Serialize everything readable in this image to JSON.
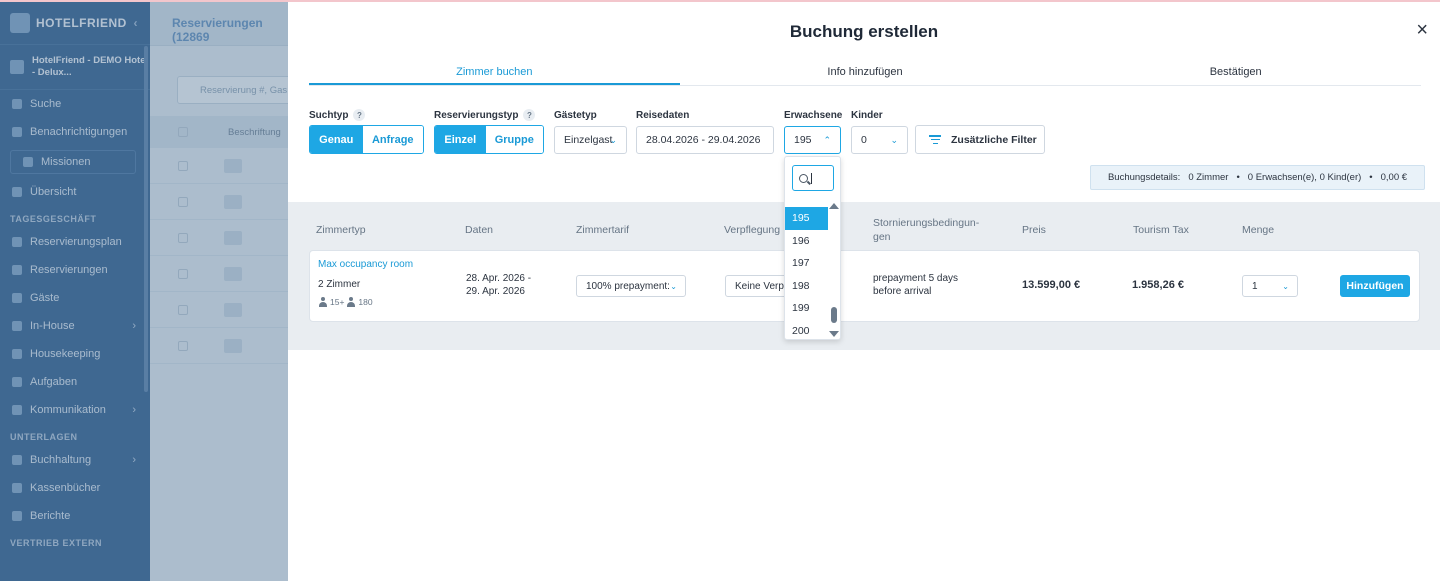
{
  "sidebar": {
    "brand": "HOTELFRIEND",
    "hotel": "HotelFriend - DEMO Hotel - Delux...",
    "items": [
      {
        "label": "Suche"
      },
      {
        "label": "Benachrichtigungen"
      },
      {
        "label": "Missionen"
      },
      {
        "label": "Übersicht"
      }
    ],
    "section_daily": "TAGESGESCHÄFT",
    "daily_items": [
      {
        "label": "Reservierungsplan"
      },
      {
        "label": "Reservierungen"
      },
      {
        "label": "Gäste"
      },
      {
        "label": "In-House"
      },
      {
        "label": "Housekeeping"
      },
      {
        "label": "Aufgaben"
      },
      {
        "label": "Kommunikation"
      }
    ],
    "section_docs": "UNTERLAGEN",
    "docs_items": [
      {
        "label": "Buchhaltung"
      },
      {
        "label": "Kassenbücher"
      },
      {
        "label": "Berichte"
      }
    ],
    "section_sales": "VERTRIEB EXTERN"
  },
  "background": {
    "tab_label": "Reservierungen (12869",
    "search_placeholder": "Reservierung #, Gas",
    "col_label": "Beschriftung"
  },
  "modal": {
    "title": "Buchung erstellen",
    "close": "×",
    "tabs": [
      "Zimmer buchen",
      "Info hinzufügen",
      "Bestätigen"
    ],
    "filters": {
      "search_type_label": "Suchtyp",
      "search_type_options": [
        "Genau",
        "Anfrage"
      ],
      "reservation_type_label": "Reservierungstyp",
      "reservation_type_options": [
        "Einzel",
        "Gruppe"
      ],
      "guest_type_label": "Gästetyp",
      "guest_type_value": "Einzelgast",
      "dates_label": "Reisedaten",
      "dates_value": "28.04.2026 - 29.04.2026",
      "adults_label": "Erwachsene",
      "adults_value": "195",
      "children_label": "Kinder",
      "children_value": "0",
      "more_filters": "Zusätzliche Filter",
      "help": "?"
    },
    "summary": {
      "label": "Buchungsdetails:",
      "rooms": "0 Zimmer",
      "guests": "0 Erwachsen(e), 0 Kind(er)",
      "total": "0,00 €"
    },
    "table_headers": {
      "room_type": "Zimmertyp",
      "dates": "Daten",
      "rate": "Zimmertarif",
      "board": "Verpflegung",
      "cancel1": "Stornierungsbedingun-",
      "cancel2": "gen",
      "price": "Preis",
      "tax": "Tourism Tax",
      "qty": "Menge"
    },
    "row": {
      "room_name": "Max occupancy room",
      "rooms": "2 Zimmer",
      "occ_adults": "15+",
      "occ_children": "180",
      "date_line1": "28. Apr. 2026 -",
      "date_line2": "29. Apr. 2026",
      "rate": "100% prepayment:",
      "board": "Keine Verpf",
      "cancel_line1": "prepayment 5 days",
      "cancel_line2": "before arrival",
      "price": "13.599,00 €",
      "tax": "1.958,26 €",
      "qty": "1",
      "add_button": "Hinzufügen"
    },
    "adults_dropdown": {
      "options": [
        "195",
        "196",
        "197",
        "198",
        "199",
        "200"
      ],
      "selected": "195"
    }
  }
}
